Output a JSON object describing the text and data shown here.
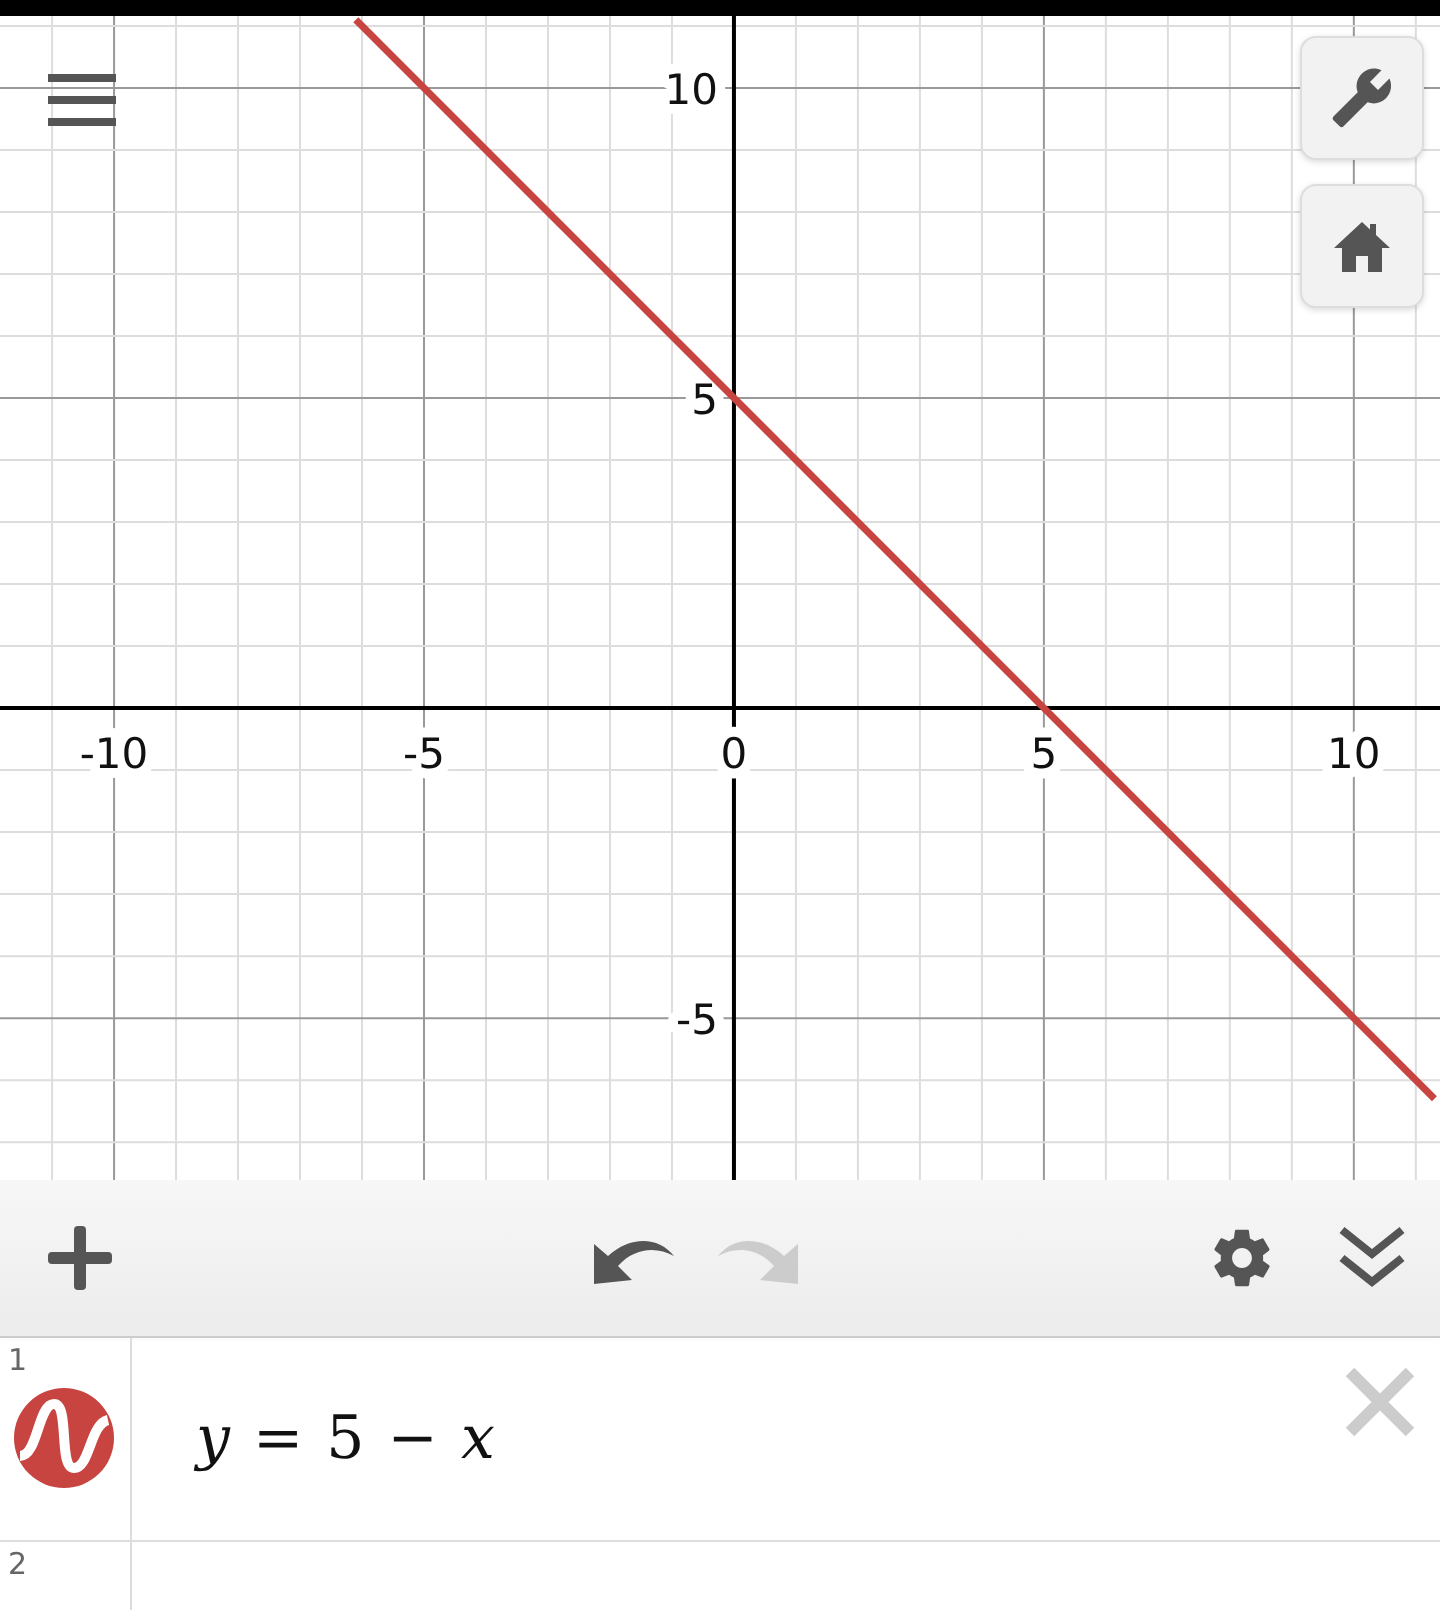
{
  "graph": {
    "chart_data": {
      "type": "line",
      "x": [
        -6.1,
        11.3
      ],
      "series": [
        {
          "color": "#c74440",
          "values": [
            11.1,
            -6.3
          ]
        }
      ],
      "xlim": [
        -11.84,
        11.39
      ],
      "ylim": [
        -7.61,
        11.16
      ],
      "xticks": [
        -10,
        -5,
        0,
        5,
        10
      ],
      "yticks": [
        -5,
        5,
        10
      ],
      "grid": true
    }
  },
  "toolbar": {
    "undo_disabled": false,
    "redo_disabled": true
  },
  "expressions": [
    {
      "number": "1",
      "text": "*y* = 5 − *x*",
      "color": "#c74440"
    },
    {
      "number": "2"
    }
  ]
}
